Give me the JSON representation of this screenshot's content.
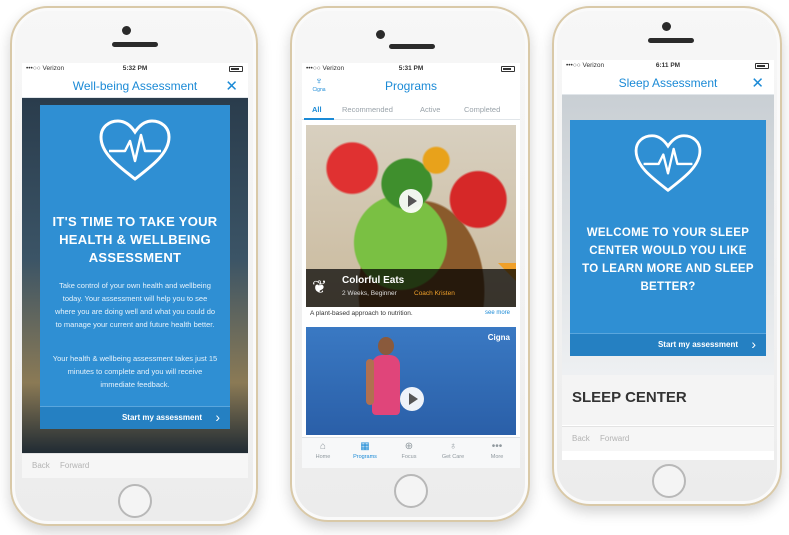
{
  "colors": {
    "brand_blue": "#1b8ad6",
    "card_blue": "#2f8fd3",
    "start_bar_blue": "#2580c2",
    "coach_orange": "#f0a02a"
  },
  "phone1": {
    "status": {
      "carrier": "•••○○ Verizon",
      "time": "5:32 PM"
    },
    "nav_title": "Well-being Assessment",
    "close_icon": "✕",
    "heading": "IT'S TIME TO TAKE YOUR HEALTH & WELLBEING ASSESSMENT",
    "paragraph1": "Take control of your own health and wellbeing today. Your assessment will help you to see where you are doing well and what you could do to manage your current and future health better.",
    "paragraph2": "Your health & wellbeing assessment takes just 15 minutes to complete and you will receive immediate feedback.",
    "start_label": "Start my assessment",
    "browser_back": "Back",
    "browser_forward": "Forward"
  },
  "phone2": {
    "status": {
      "carrier": "•••○○ Verizon",
      "time": "5:31 PM"
    },
    "logo": "Cigna",
    "nav_title": "Programs",
    "tabs": [
      "All",
      "Recommended",
      "Active",
      "Completed"
    ],
    "card1": {
      "title": "Colorful Eats",
      "meta": "2 Weeks, Beginner",
      "coach": "Coach Kristen",
      "desc": "A plant-based approach to nutrition.",
      "see_more": "see more"
    },
    "card2_brand": "Cigna",
    "bottom_tabs": [
      {
        "label": "Home",
        "icon": "home-icon"
      },
      {
        "label": "Programs",
        "icon": "programs-icon"
      },
      {
        "label": "Focus",
        "icon": "focus-icon"
      },
      {
        "label": "Get Care",
        "icon": "stethoscope-icon"
      },
      {
        "label": "More",
        "icon": "more-icon"
      }
    ]
  },
  "phone3": {
    "status": {
      "carrier": "•••○○ Verizon",
      "time": "6:11 PM"
    },
    "nav_title": "Sleep Assessment",
    "close_icon": "✕",
    "heading": "WELCOME TO YOUR SLEEP CENTER WOULD YOU LIKE TO LEARN MORE AND SLEEP BETTER?",
    "start_label": "Start my assessment",
    "section_title": "SLEEP CENTER",
    "browser_back": "Back",
    "browser_forward": "Forward"
  }
}
